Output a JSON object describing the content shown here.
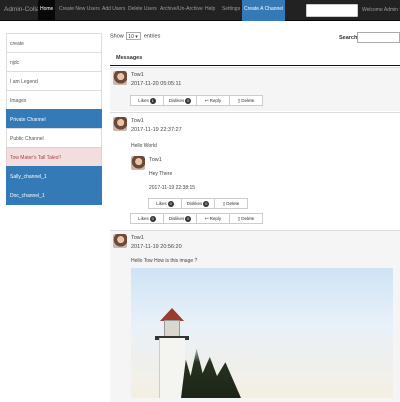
{
  "navbar": {
    "brand": "Admin-Collab",
    "items": [
      "Home",
      "Create New Users",
      "Add Users",
      "Delete Users",
      "Archive/Un-Archive",
      "Help",
      "Settings",
      "Create A Channel"
    ],
    "user": "Welcome Admin",
    "user_caret": "▾"
  },
  "sidebar": {
    "items": [
      {
        "label": "create",
        "style": "default"
      },
      {
        "label": "njdc",
        "style": "default"
      },
      {
        "label": "I am Legend",
        "style": "default"
      },
      {
        "label": "Images",
        "style": "default"
      },
      {
        "label": "Private Channel",
        "style": "blue"
      },
      {
        "label": "Public Channel",
        "style": "default"
      },
      {
        "label": "Tow Mater's Tall Tales!!",
        "style": "pink"
      },
      {
        "label": "Sally_channel_1",
        "style": "blue"
      },
      {
        "label": "Doc_channel_1",
        "style": "blue"
      }
    ]
  },
  "table": {
    "show_prefix": "Show",
    "entries_value": "10",
    "show_suffix": "entries",
    "search_label": "Search:",
    "header": "Messages"
  },
  "actions": {
    "likes": "Likes",
    "dislikes": "Dislikes",
    "reply": "Reply",
    "delete": "Delete"
  },
  "posts": [
    {
      "name": "Tow1",
      "time": "2017-11-20 05:05:11",
      "text": "",
      "likes": "1",
      "dislikes": "0"
    },
    {
      "name": "Tow1",
      "time": "2017-11-19 22:37:27",
      "text": "Hello World",
      "likes": "0",
      "dislikes": "0",
      "reply": {
        "name": "Tow1",
        "text": "Hey There",
        "time": "2017-11-19 22:38:15",
        "likes": "0",
        "dislikes": "0"
      }
    },
    {
      "name": "Tow1",
      "time": "2017-11-19 20:56:20",
      "text": "Hello Tow How is this image ?",
      "likes": "",
      "dislikes": ""
    }
  ]
}
